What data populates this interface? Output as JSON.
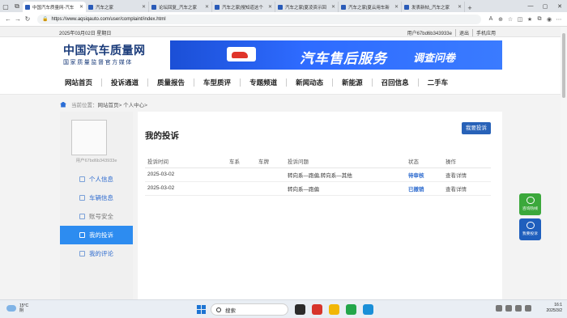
{
  "browser": {
    "tabs": [
      {
        "title": "中国汽车质量网-汽车",
        "active": true
      },
      {
        "title": "汽车之家",
        "active": false
      },
      {
        "title": "论坛回复_汽车之家",
        "active": false
      },
      {
        "title": "汽车之家|搜知道这个",
        "active": false
      },
      {
        "title": "汽车之家|夏凌资示回",
        "active": false
      },
      {
        "title": "汽车之家|夏云用车新",
        "active": false
      },
      {
        "title": "发表新帖_汽车之家",
        "active": false
      }
    ],
    "url": "https://www.aqsiqauto.com/user/complaint/index.html"
  },
  "topbar": {
    "date": "2025年03月02日 星期日",
    "user": "用户67bd6b343933e",
    "logout": "退出",
    "mobile": "手机应用"
  },
  "header": {
    "logo_title": "中国汽车质量网",
    "logo_subtitle": "国家质量监督官方媒体",
    "banner_main": "汽车售后服务",
    "banner_sub": "调查问卷"
  },
  "nav": {
    "items": [
      "网站首页",
      "投诉通道",
      "质量报告",
      "车型质评",
      "专题频道",
      "新闻动态",
      "新能源",
      "召回信息",
      "二手车"
    ]
  },
  "breadcrumb": {
    "label": "当前位置：",
    "path": "网站首页> 个人中心>"
  },
  "sidebar": {
    "user_id": "用户67bd6b343933e",
    "menu": [
      {
        "label": "个人信息",
        "icon": "person-icon"
      },
      {
        "label": "车辆信息",
        "icon": "car-icon"
      },
      {
        "label": "账号安全",
        "icon": "shield-icon"
      },
      {
        "label": "我的投诉",
        "icon": "megaphone-icon"
      },
      {
        "label": "我的评论",
        "icon": "comment-icon"
      }
    ]
  },
  "main": {
    "title": "我的投诉",
    "new_button": "我要投诉",
    "columns": [
      "投诉时间",
      "车系",
      "车牌",
      "投诉问题",
      "状态",
      "操作"
    ],
    "rows": [
      {
        "time": "2025-03-02",
        "series": "",
        "plate": "",
        "issue": "转向系—跑偏,转向系—其他",
        "status": "待审核",
        "action": "查看详情"
      },
      {
        "time": "2025-03-02",
        "series": "",
        "plate": "",
        "issue": "转向系—跑偏",
        "status": "已撤销",
        "action": "查看详情"
      }
    ]
  },
  "floating": {
    "hotline": "咨询热线",
    "complain": "我要投诉"
  },
  "taskbar": {
    "temperature": "15°C",
    "weather": "阴",
    "search": "搜索",
    "time": "16:1",
    "date": "2025/3/2"
  }
}
